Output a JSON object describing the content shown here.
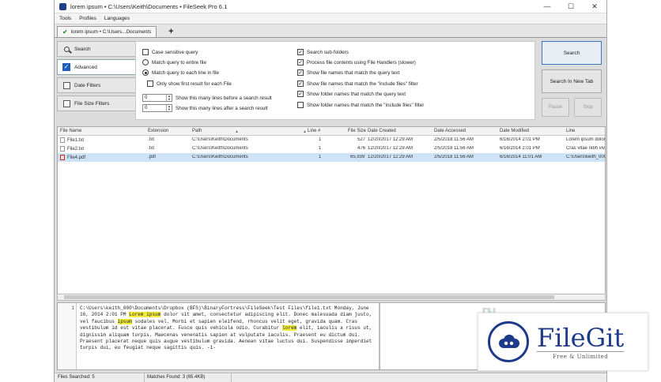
{
  "window": {
    "title": "lorem ipsum • C:\\Users\\Keith\\Documents • FileSeek Pro 6.1",
    "controls": [
      "—",
      "☐",
      "✕"
    ]
  },
  "menu": [
    "Tools",
    "Profiles",
    "Languages"
  ],
  "tabs": [
    {
      "label": "lorem ipsum • C:\\Users...",
      "label_em": "Documents"
    }
  ],
  "tab_add": "+",
  "nav": {
    "items": [
      {
        "label": "Search",
        "icon": "magnifier-icon"
      },
      {
        "label": "Advanced",
        "icon": "checkbox-checked-icon"
      },
      {
        "label": "Date Filters",
        "icon": "checkbox-icon"
      },
      {
        "label": "File Size Filters",
        "icon": "checkbox-icon"
      }
    ]
  },
  "options": {
    "case_sensitive": {
      "label": "Case sensitive query",
      "checked": false
    },
    "match_entire_file": {
      "label": "Match query to entire file",
      "selected": false
    },
    "match_each_line": {
      "label": "Match query to each line in file",
      "selected": true
    },
    "first_result_only": {
      "label": "Only show first result for each File",
      "checked": false
    },
    "lines_before": {
      "value": "0",
      "label": "Show this many lines before a search result"
    },
    "lines_after": {
      "value": "0",
      "label": "Show this many lines after a search result"
    },
    "search_subfolders": {
      "label": "Search sub-folders",
      "checked": true
    },
    "file_handlers": {
      "label": "Process file contents using File Handlers (slower)",
      "checked": true
    },
    "names_match_query": {
      "label": "Show file names that match the query text",
      "checked": true
    },
    "names_match_include": {
      "label": "Show file names that match the \"include files\" filter",
      "checked": true
    },
    "folders_match_query": {
      "label": "Show folder names that match the query text",
      "checked": true
    },
    "folders_match_include": {
      "label": "Show folder names that match the \"include files\" filter",
      "checked": false
    }
  },
  "buttons": {
    "search": "Search",
    "search_new_tab": "Search In New Tab",
    "pause": "Pause",
    "stop": "Stop"
  },
  "results": {
    "columns": [
      "File Name",
      "Extension",
      "Path",
      "Line #",
      "File Size",
      "Date Created",
      "Date Accessed",
      "Date Modified",
      "Line"
    ],
    "rows": [
      {
        "name": "File1.txt",
        "ext": ".txt",
        "path": "C:\\Users\\Keith\\Documents",
        "line": "1",
        "size": "527",
        "created": "12/20/2017 12:29 AM",
        "accessed": "2/5/2018 11:56 AM",
        "modified": "6/16/2014 2:01 PM",
        "text": "Lorem ipsum dolor",
        "type": "txt",
        "selected": false
      },
      {
        "name": "File2.txt",
        "ext": ".txt",
        "path": "C:\\Users\\Keith\\Documents",
        "line": "1",
        "size": "476",
        "created": "12/20/2017 12:29 AM",
        "accessed": "2/5/2018 11:56 AM",
        "modified": "6/16/2014 2:01 PM",
        "text": "Cras vitae nibh viv",
        "type": "txt",
        "selected": false
      },
      {
        "name": "File4.pdf",
        "ext": ".pdf",
        "path": "C:\\Users\\Keith\\Documents",
        "line": "1",
        "size": "65,939",
        "created": "12/20/2017 12:29 AM",
        "accessed": "2/5/2018 11:56 AM",
        "modified": "6/16/2014 11:01 AM",
        "text": "C:\\Users\\keith_000",
        "type": "pdf",
        "selected": true
      }
    ]
  },
  "preview": {
    "line_no": "1",
    "seg1": "C:\\Users\\keith_000\\Documents\\Dropbox (BFS)\\BinaryFortress\\FileSeek\\Test Files\\file1.txt Monday, June 16, 2014 2:01 PM ",
    "hl1": "Lorem ipsum",
    "seg2": " dolor sit amet, consectetur adipiscing elit. Donec malesuada diam justo, vel faucibus ",
    "hl2": "ipsum",
    "seg3": " sodales vel. Morbi et sapien eleifend, rhoncus velit eget, gravida quam. Cras vestibulum id est vitae placerat. Fusce quis vehicula odio. Curabitur ",
    "hl3": "lorem",
    "seg4": " elit, iaculis a risus ut, dignissim aliquam turpis. Maecenas venenatis sapien at vulputate iaculis. Praesent eu dictum dui. Praesent placerat neque quis augue vestibulum gravida. Aenean vitae luctus dui. Suspendisse imperdiet turpis dui, eu feugiat neque sagittis quis. -1-"
  },
  "status": {
    "files_searched": "Files Searched: 5",
    "matches_found": "Matches Found: 3 (65.4KB)"
  },
  "ghost_logo": "FI",
  "watermark": {
    "title": "FileGit",
    "subtitle": "Free & Unlimited"
  },
  "colors": {
    "accent": "#1f5fbf",
    "selection": "#cde3f7",
    "highlight": "#f3ec3a",
    "watermark": "#1e3a8a"
  }
}
